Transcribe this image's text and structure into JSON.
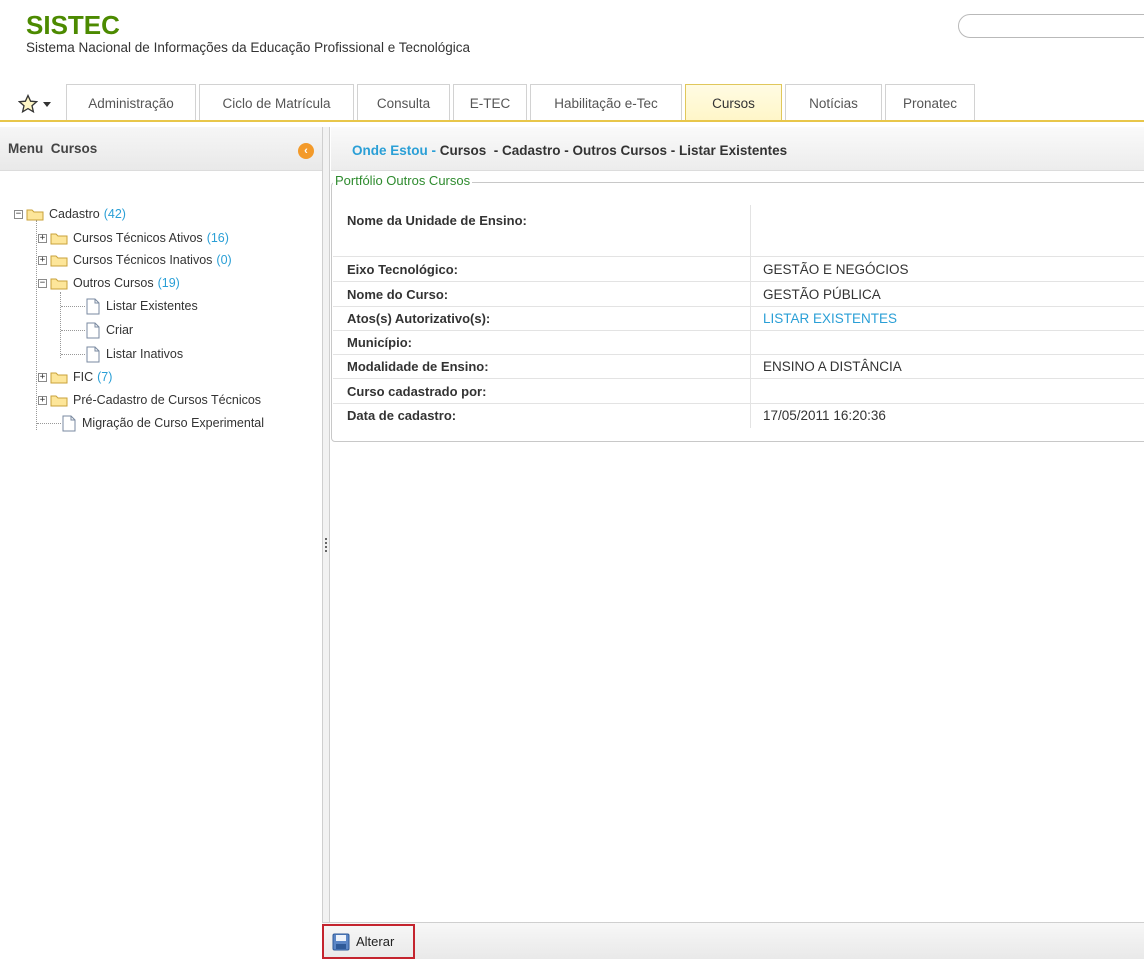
{
  "app": {
    "title": "SISTEC",
    "subtitle": "Sistema Nacional de Informações da Educação Profissional e Tecnológica"
  },
  "tabs": [
    {
      "label": "Administração"
    },
    {
      "label": "Ciclo de Matrícula"
    },
    {
      "label": "Consulta"
    },
    {
      "label": "E-TEC"
    },
    {
      "label": "Habilitação e-Tec"
    },
    {
      "label": "Cursos",
      "active": true
    },
    {
      "label": "Notícias"
    },
    {
      "label": "Pronatec"
    }
  ],
  "sidebar": {
    "header": "Menu  Cursos",
    "tree": [
      {
        "label": "Cadastro",
        "count": "(42)"
      },
      {
        "label": "Cursos Técnicos Ativos",
        "count": "(16)"
      },
      {
        "label": "Cursos Técnicos Inativos",
        "count": "(0)"
      },
      {
        "label": "Outros Cursos",
        "count": "(19)"
      },
      {
        "label": "Listar Existentes"
      },
      {
        "label": "Criar"
      },
      {
        "label": "Listar Inativos"
      },
      {
        "label": "FIC",
        "count": "(7)"
      },
      {
        "label": "Pré-Cadastro de Cursos Técnicos"
      },
      {
        "label": "Migração de Curso Experimental"
      }
    ]
  },
  "breadcrumb": {
    "prefix": "Onde Estou",
    "separator": " - ",
    "path": "Cursos  - Cadastro - Outros Cursos - Listar Existentes"
  },
  "portfolio": {
    "legend": "Portfólio Outros Cursos",
    "rows": [
      {
        "label": "Nome da Unidade de Ensino:",
        "value": ""
      },
      {
        "label": "Eixo Tecnológico:",
        "value": "GESTÃO E NEGÓCIOS"
      },
      {
        "label": "Nome do Curso:",
        "value": "GESTÃO PÚBLICA"
      },
      {
        "label": "Atos(s) Autorizativo(s):",
        "value": "LISTAR EXISTENTES"
      },
      {
        "label": "Município:",
        "value": ""
      },
      {
        "label": "Modalidade de Ensino:",
        "value": "ENSINO A DISTÂNCIA"
      },
      {
        "label": "Curso cadastrado por:",
        "value": ""
      },
      {
        "label": "Data de cadastro:",
        "value": "17/05/2011 16:20:36"
      }
    ]
  },
  "footer": {
    "alter_label": "Alterar"
  },
  "colors": {
    "brand": "#4c8a00",
    "link": "#2a9fd6",
    "active_tab_border": "#e0c75b",
    "highlight_border": "#c4242e"
  }
}
